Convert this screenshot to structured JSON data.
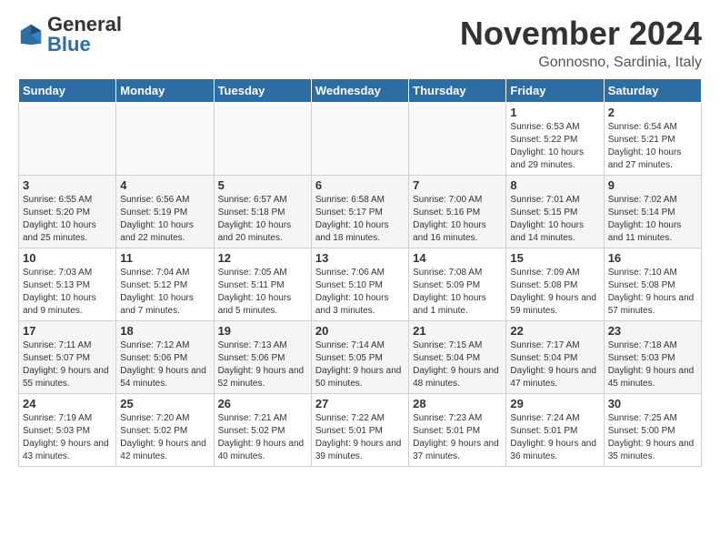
{
  "logo": {
    "general": "General",
    "blue": "Blue"
  },
  "header": {
    "month": "November 2024",
    "location": "Gonnosno, Sardinia, Italy"
  },
  "weekdays": [
    "Sunday",
    "Monday",
    "Tuesday",
    "Wednesday",
    "Thursday",
    "Friday",
    "Saturday"
  ],
  "weeks": [
    [
      {
        "day": "",
        "info": ""
      },
      {
        "day": "",
        "info": ""
      },
      {
        "day": "",
        "info": ""
      },
      {
        "day": "",
        "info": ""
      },
      {
        "day": "",
        "info": ""
      },
      {
        "day": "1",
        "info": "Sunrise: 6:53 AM\nSunset: 5:22 PM\nDaylight: 10 hours and 29 minutes."
      },
      {
        "day": "2",
        "info": "Sunrise: 6:54 AM\nSunset: 5:21 PM\nDaylight: 10 hours and 27 minutes."
      }
    ],
    [
      {
        "day": "3",
        "info": "Sunrise: 6:55 AM\nSunset: 5:20 PM\nDaylight: 10 hours and 25 minutes."
      },
      {
        "day": "4",
        "info": "Sunrise: 6:56 AM\nSunset: 5:19 PM\nDaylight: 10 hours and 22 minutes."
      },
      {
        "day": "5",
        "info": "Sunrise: 6:57 AM\nSunset: 5:18 PM\nDaylight: 10 hours and 20 minutes."
      },
      {
        "day": "6",
        "info": "Sunrise: 6:58 AM\nSunset: 5:17 PM\nDaylight: 10 hours and 18 minutes."
      },
      {
        "day": "7",
        "info": "Sunrise: 7:00 AM\nSunset: 5:16 PM\nDaylight: 10 hours and 16 minutes."
      },
      {
        "day": "8",
        "info": "Sunrise: 7:01 AM\nSunset: 5:15 PM\nDaylight: 10 hours and 14 minutes."
      },
      {
        "day": "9",
        "info": "Sunrise: 7:02 AM\nSunset: 5:14 PM\nDaylight: 10 hours and 11 minutes."
      }
    ],
    [
      {
        "day": "10",
        "info": "Sunrise: 7:03 AM\nSunset: 5:13 PM\nDaylight: 10 hours and 9 minutes."
      },
      {
        "day": "11",
        "info": "Sunrise: 7:04 AM\nSunset: 5:12 PM\nDaylight: 10 hours and 7 minutes."
      },
      {
        "day": "12",
        "info": "Sunrise: 7:05 AM\nSunset: 5:11 PM\nDaylight: 10 hours and 5 minutes."
      },
      {
        "day": "13",
        "info": "Sunrise: 7:06 AM\nSunset: 5:10 PM\nDaylight: 10 hours and 3 minutes."
      },
      {
        "day": "14",
        "info": "Sunrise: 7:08 AM\nSunset: 5:09 PM\nDaylight: 10 hours and 1 minute."
      },
      {
        "day": "15",
        "info": "Sunrise: 7:09 AM\nSunset: 5:08 PM\nDaylight: 9 hours and 59 minutes."
      },
      {
        "day": "16",
        "info": "Sunrise: 7:10 AM\nSunset: 5:08 PM\nDaylight: 9 hours and 57 minutes."
      }
    ],
    [
      {
        "day": "17",
        "info": "Sunrise: 7:11 AM\nSunset: 5:07 PM\nDaylight: 9 hours and 55 minutes."
      },
      {
        "day": "18",
        "info": "Sunrise: 7:12 AM\nSunset: 5:06 PM\nDaylight: 9 hours and 54 minutes."
      },
      {
        "day": "19",
        "info": "Sunrise: 7:13 AM\nSunset: 5:06 PM\nDaylight: 9 hours and 52 minutes."
      },
      {
        "day": "20",
        "info": "Sunrise: 7:14 AM\nSunset: 5:05 PM\nDaylight: 9 hours and 50 minutes."
      },
      {
        "day": "21",
        "info": "Sunrise: 7:15 AM\nSunset: 5:04 PM\nDaylight: 9 hours and 48 minutes."
      },
      {
        "day": "22",
        "info": "Sunrise: 7:17 AM\nSunset: 5:04 PM\nDaylight: 9 hours and 47 minutes."
      },
      {
        "day": "23",
        "info": "Sunrise: 7:18 AM\nSunset: 5:03 PM\nDaylight: 9 hours and 45 minutes."
      }
    ],
    [
      {
        "day": "24",
        "info": "Sunrise: 7:19 AM\nSunset: 5:03 PM\nDaylight: 9 hours and 43 minutes."
      },
      {
        "day": "25",
        "info": "Sunrise: 7:20 AM\nSunset: 5:02 PM\nDaylight: 9 hours and 42 minutes."
      },
      {
        "day": "26",
        "info": "Sunrise: 7:21 AM\nSunset: 5:02 PM\nDaylight: 9 hours and 40 minutes."
      },
      {
        "day": "27",
        "info": "Sunrise: 7:22 AM\nSunset: 5:01 PM\nDaylight: 9 hours and 39 minutes."
      },
      {
        "day": "28",
        "info": "Sunrise: 7:23 AM\nSunset: 5:01 PM\nDaylight: 9 hours and 37 minutes."
      },
      {
        "day": "29",
        "info": "Sunrise: 7:24 AM\nSunset: 5:01 PM\nDaylight: 9 hours and 36 minutes."
      },
      {
        "day": "30",
        "info": "Sunrise: 7:25 AM\nSunset: 5:00 PM\nDaylight: 9 hours and 35 minutes."
      }
    ]
  ]
}
